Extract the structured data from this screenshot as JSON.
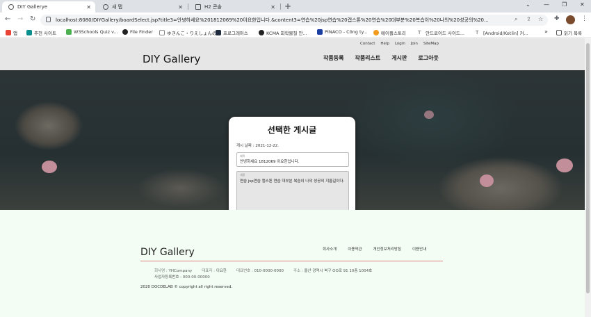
{
  "browser": {
    "tabs": [
      {
        "label": "DIY Gallerye",
        "active": true
      },
      {
        "label": "새 탭",
        "active": false
      },
      {
        "label": "H2 콘솔",
        "active": false
      }
    ],
    "new_tab_label": "+",
    "window_controls": [
      "⌄",
      "—",
      "❐",
      "✕"
    ],
    "url": "localhost:8080/DIYGallery/boardSelect.jsp?title3=안녕하세요%201812069%20이요한입니다.&content3=연습%20jsp연습%20캡스톤%20연습%20대부분%20복습이%20나의%20성공의%20...",
    "bookmarks": [
      {
        "label": "앱",
        "icon": "apps-grid-icon",
        "color": "#ea4335"
      },
      {
        "label": "추천 사이트",
        "icon": "bing-icon",
        "color": "#0a8f8f"
      },
      {
        "label": "W3Schools Quiz v...",
        "icon": "w3schools-icon",
        "color": "#4caf50"
      },
      {
        "label": "File Finder",
        "icon": "github-icon",
        "color": "#222222"
      },
      {
        "label": "ゆきんこ・りえしょんの...",
        "icon": "page-icon",
        "color": "#888888"
      },
      {
        "label": "프로그래머스",
        "icon": "programmers-icon",
        "color": "#1e2b3c"
      },
      {
        "label": "KCMA 화학물질 안...",
        "icon": "kcma-icon",
        "color": "#222222"
      },
      {
        "label": "PINACO - Công ty...",
        "icon": "pinaco-icon",
        "color": "#1a3fa0"
      },
      {
        "label": "메이플스토리",
        "icon": "maple-icon",
        "color": "#f29b1f"
      },
      {
        "label": "안드로이드 사이드...",
        "icon": "text-icon",
        "color": "#555555"
      },
      {
        "label": "[Android/Kotlin] 커...",
        "icon": "text-icon",
        "color": "#555555"
      },
      {
        "label": "»",
        "icon": "more-icon",
        "color": "#555555"
      },
      {
        "label": "읽기 목록",
        "icon": "reading-list-icon",
        "color": "#555555"
      }
    ]
  },
  "site": {
    "util_nav": [
      "Contact",
      "Help",
      "Login",
      "Join",
      "SiteMap"
    ],
    "logo": "DIY Gallery",
    "main_nav": [
      "작품등록",
      "작품리스트",
      "게시판",
      "로그아웃"
    ]
  },
  "card": {
    "heading": "선택한 게시글",
    "date": "게시 날짜 : 2021-12-22.",
    "title_label": "제목",
    "title_value": "안녕하세요 1812069 이요한입니다.",
    "content_label": "내용",
    "content_value": "연습 jsp연습 캡스톤 연습 대부분 복습이 나의 성공의 지름길이다."
  },
  "footer": {
    "logo": "DIY Gallery",
    "nav": [
      "회사소개",
      "이용약관",
      "개인정보처리방침",
      "이용안내"
    ],
    "company_label": "회사명 :",
    "company": "YHCompany",
    "ceo_label": "대표자 :",
    "ceo": "이요한",
    "phone_label": "대표번호 :",
    "phone": "010-0000-0000",
    "address_label": "주소 :",
    "address": "울산 광역시 북구 OO로 91 10층 1004호",
    "biz_no": "사업자등록번호 : 000-00-00000",
    "copyright": "2020 DOCDELAB © copyright all right reserved."
  }
}
